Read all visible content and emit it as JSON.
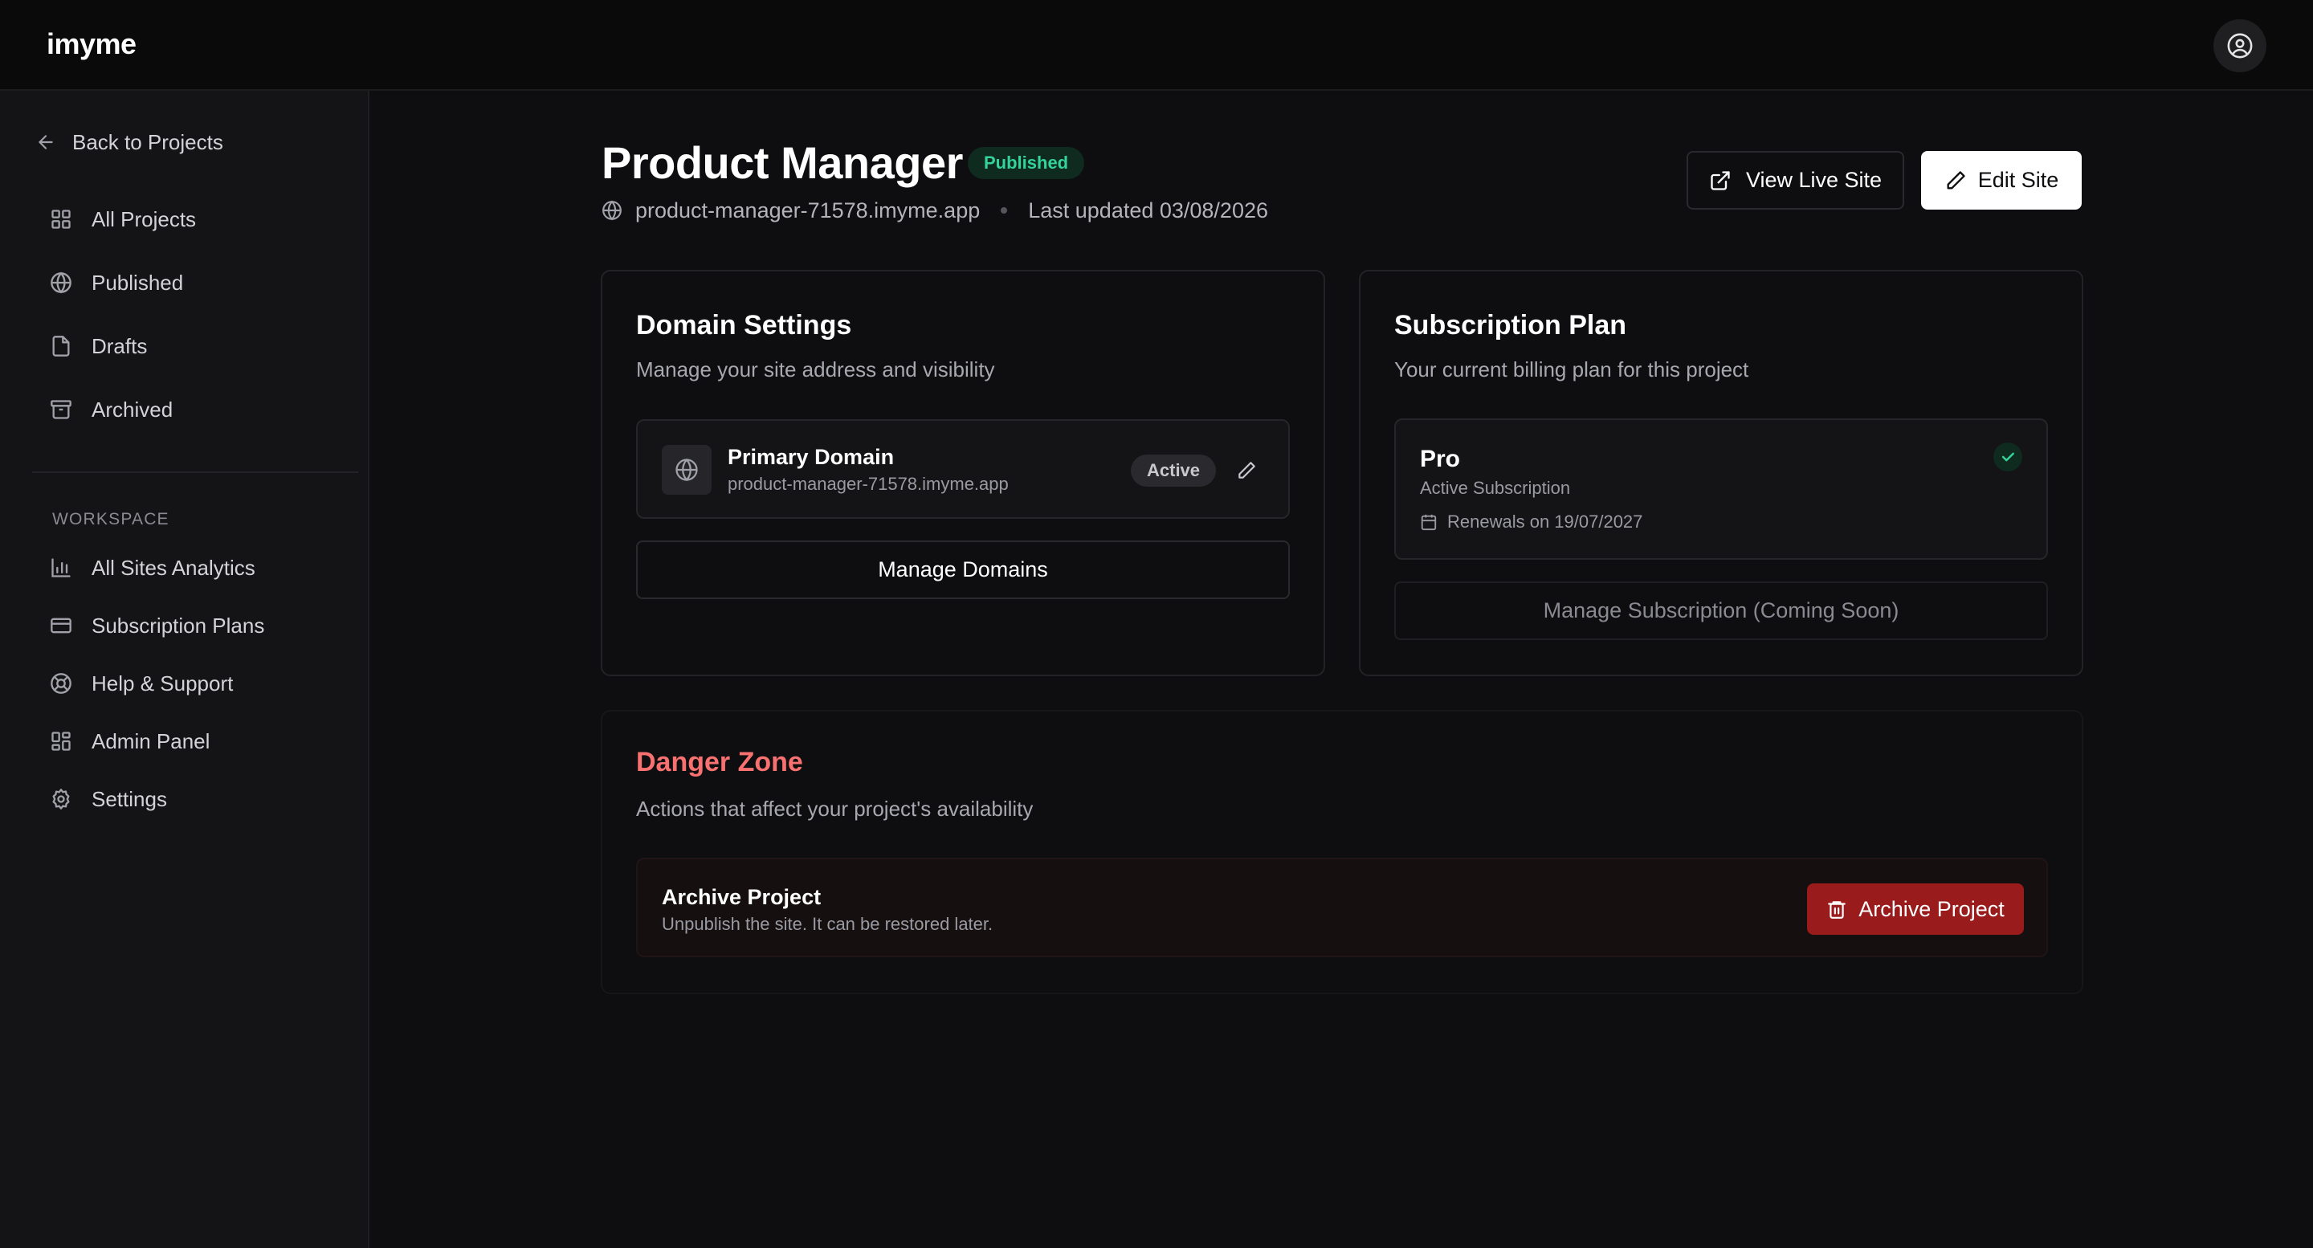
{
  "app": {
    "name": "imyme"
  },
  "sidebar": {
    "back_label": "Back to Projects",
    "items": [
      {
        "label": "All Projects",
        "icon": "grid-icon"
      },
      {
        "label": "Published",
        "icon": "globe-icon"
      },
      {
        "label": "Drafts",
        "icon": "file-icon"
      },
      {
        "label": "Archived",
        "icon": "archive-icon"
      }
    ],
    "workspace_label": "WORKSPACE",
    "workspace_items": [
      {
        "label": "All Sites Analytics",
        "icon": "bar-chart-icon"
      },
      {
        "label": "Subscription Plans",
        "icon": "credit-card-icon"
      },
      {
        "label": "Help & Support",
        "icon": "lifebuoy-icon"
      },
      {
        "label": "Admin Panel",
        "icon": "grid-icon"
      },
      {
        "label": "Settings",
        "icon": "gear-icon"
      }
    ]
  },
  "project": {
    "title": "Product Manager",
    "status": "Published",
    "url": "product-manager-71578.imyme.app",
    "last_updated": "Last updated 03/08/2026"
  },
  "actions": {
    "view_live": "View Live Site",
    "edit": "Edit Site"
  },
  "domain_settings": {
    "title": "Domain Settings",
    "description": "Manage your site address and visibility",
    "primary_label": "Primary Domain",
    "primary_url": "product-manager-71578.imyme.app",
    "status": "Active",
    "manage_label": "Manage Domains"
  },
  "subscription": {
    "title": "Subscription Plan",
    "description": "Your current billing plan for this project",
    "plan_name": "Pro",
    "plan_status": "Active Subscription",
    "renewal": "Renewals on 19/07/2027",
    "manage_label": "Manage Subscription (Coming Soon)"
  },
  "danger_zone": {
    "title": "Danger Zone",
    "description": "Actions that affect your project's availability",
    "archive_title": "Archive Project",
    "archive_description": "Unpublish the site. It can be restored later.",
    "archive_button": "Archive Project"
  },
  "colors": {
    "background": "#0e0e10",
    "accent_green": "#34d399",
    "danger_red": "#f87171",
    "danger_button": "#991b1b"
  }
}
